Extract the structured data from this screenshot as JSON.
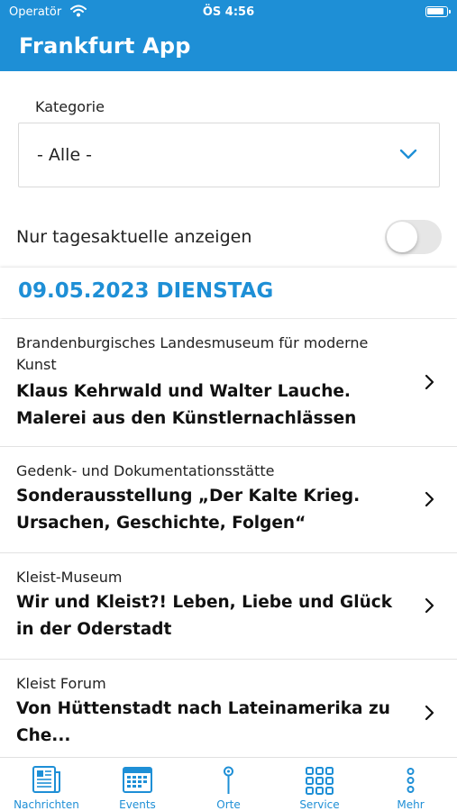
{
  "status_bar": {
    "carrier": "Operatör",
    "time": "ÖS 4:56"
  },
  "header": {
    "title": "Frankfurt App"
  },
  "filter": {
    "category_label": "Kategorie",
    "category_value": "- Alle -",
    "today_only_label": "Nur tagesaktuelle anzeigen",
    "today_only_on": false
  },
  "date_header": "09.05.2023 DIENSTAG",
  "events": [
    {
      "venue": "Brandenburgisches Landesmuseum für moderne Kunst",
      "title": "Klaus Kehrwald und Walter Lauche. Malerei aus den Künstlernachlässen"
    },
    {
      "venue": "Gedenk- und Dokumentationsstätte",
      "title": "Sonderausstellung „Der Kalte Krieg. Ursachen, Geschichte, Folgen“"
    },
    {
      "venue": "Kleist-Museum",
      "title": "Wir und Kleist?! Leben, Liebe und Glück in der Oderstadt"
    },
    {
      "venue": "Kleist Forum",
      "title": "Von Hüttenstadt nach Lateinamerika zu Che..."
    }
  ],
  "tabs": [
    {
      "label": "Nachrichten",
      "icon": "newspaper-icon"
    },
    {
      "label": "Events",
      "icon": "calendar-icon"
    },
    {
      "label": "Orte",
      "icon": "map-pin-icon"
    },
    {
      "label": "Service",
      "icon": "grid-icon"
    },
    {
      "label": "Mehr",
      "icon": "more-vertical-icon"
    }
  ],
  "colors": {
    "accent": "#1e8fd6",
    "toggle_off": "#e6e6e6",
    "divider": "#e2e2e2"
  }
}
